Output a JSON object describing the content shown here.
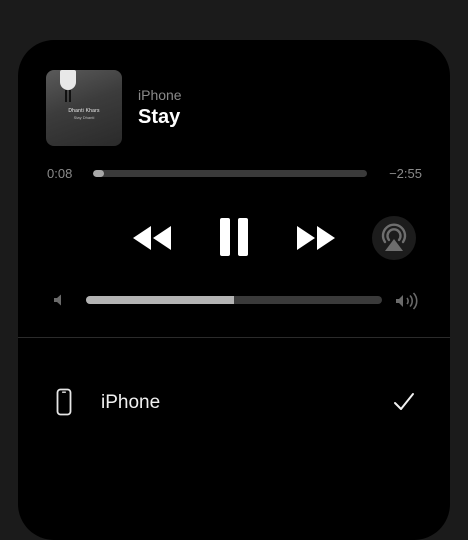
{
  "now_playing": {
    "source": "iPhone",
    "title": "Stay",
    "artwork": {
      "title_text": "Dhanti Khars",
      "subtitle_text": "Stay Dhanti"
    }
  },
  "progress": {
    "elapsed": "0:08",
    "remaining": "−2:55",
    "fraction": 0.04
  },
  "controls": {
    "rewind_icon": "rewind-icon",
    "pause_icon": "pause-icon",
    "forward_icon": "fast-forward-icon",
    "airplay_icon": "airplay-audio-icon"
  },
  "volume": {
    "level": 0.5,
    "min_icon": "speaker-low-icon",
    "max_icon": "speaker-high-icon"
  },
  "devices": [
    {
      "label": "iPhone",
      "icon": "iphone-icon",
      "selected": true
    }
  ],
  "colors": {
    "background": "#1b1b1b",
    "panel": "#000000",
    "secondary_text": "#8a8a8a",
    "track": "#3a3a3a"
  }
}
